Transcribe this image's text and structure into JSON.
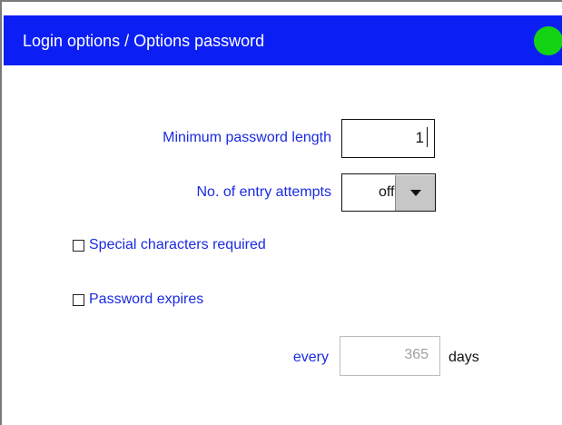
{
  "header": {
    "title": "Login options / Options password",
    "status_color": "#14d314"
  },
  "min_password_length": {
    "label": "Minimum password length",
    "value": "1"
  },
  "entry_attempts": {
    "label": "No. of entry attempts",
    "value": "off"
  },
  "special_characters": {
    "label": "Special characters required",
    "checked": false
  },
  "password_expires": {
    "label": "Password expires",
    "checked": false
  },
  "expiry": {
    "prefix": "every",
    "value": "365",
    "unit": "days"
  },
  "colors": {
    "titlebar": "#0b1ff5",
    "label_text": "#1a2be0",
    "status_ok": "#14d314"
  }
}
